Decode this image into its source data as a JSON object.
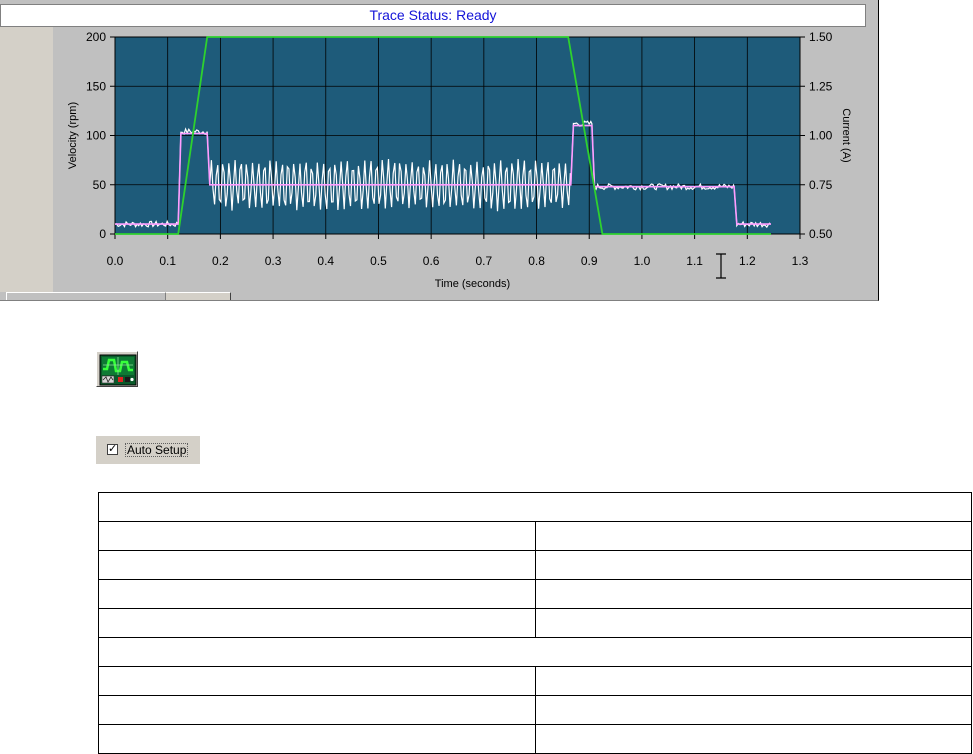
{
  "trace_window": {
    "status_label": "Trace Status:",
    "status_value": "Ready"
  },
  "chart_data": {
    "type": "line",
    "xlabel": "Time (seconds)",
    "ylabel_left": "Velocity (rpm)",
    "ylabel_right": "Current (A)",
    "xlim": [
      0.0,
      1.3
    ],
    "ylim_left": [
      0,
      200
    ],
    "ylim_right": [
      0.5,
      1.5
    ],
    "x_ticks": [
      "0.0",
      "0.1",
      "0.2",
      "0.3",
      "0.4",
      "0.5",
      "0.6",
      "0.7",
      "0.8",
      "0.9",
      "1.0",
      "1.1",
      "1.2",
      "1.3"
    ],
    "y_ticks_left": [
      "0",
      "50",
      "100",
      "150",
      "200"
    ],
    "y_ticks_right": [
      "0.50",
      "0.75",
      "1.00",
      "1.25",
      "1.50"
    ],
    "grid": true,
    "colors": {
      "plot_background": "#1e5b7a",
      "grid": "#000000",
      "velocity": "#2ed12e",
      "current_filtered": "#ff9cff",
      "current_raw": "#ffffff"
    },
    "series": [
      {
        "axis": "left",
        "x": [
          0.0,
          0.12,
          0.175,
          0.86,
          0.925,
          1.245
        ],
        "values": [
          0,
          0,
          200,
          200,
          0,
          0
        ]
      },
      {
        "axis": "right",
        "x": [
          0.0,
          0.12,
          0.125,
          0.175,
          0.18,
          0.865,
          0.87,
          0.905,
          0.91,
          1.175,
          1.18,
          1.245
        ],
        "values": [
          0.55,
          0.55,
          1.01,
          1.01,
          0.75,
          0.75,
          1.05,
          1.05,
          0.74,
          0.74,
          0.55,
          0.55
        ]
      },
      {
        "axis": "right",
        "noisy": true,
        "x": [
          0.0,
          0.12,
          0.125,
          0.175,
          0.18,
          0.865,
          0.87,
          0.905,
          0.91,
          1.175,
          1.18,
          1.245
        ],
        "values": [
          0.55,
          0.55,
          1.02,
          1.02,
          0.75,
          0.75,
          1.06,
          1.06,
          0.74,
          0.74,
          0.55,
          0.55
        ]
      }
    ]
  },
  "toolbar": {
    "scope_icon": "oscilloscope-icon"
  },
  "auto_setup": {
    "checked": true,
    "check_glyph": "✓",
    "label": "Auto Setup"
  },
  "param_table": {
    "rows": [
      [
        "",
        null
      ],
      [
        "",
        ""
      ],
      [
        "",
        ""
      ],
      [
        "",
        ""
      ],
      [
        "",
        ""
      ],
      [
        "",
        null
      ],
      [
        "",
        ""
      ],
      [
        "",
        ""
      ],
      [
        "",
        ""
      ]
    ]
  }
}
